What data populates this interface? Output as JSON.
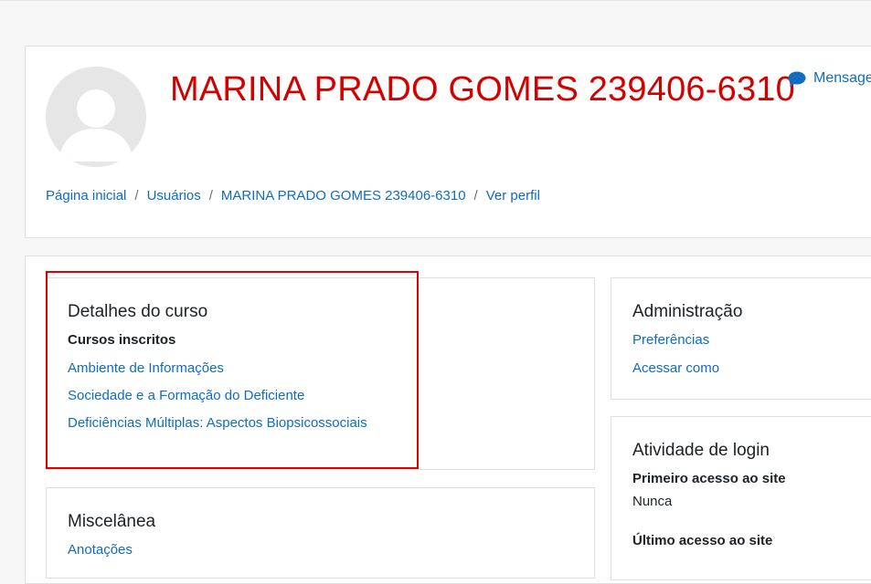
{
  "header": {
    "title": "MARINA PRADO GOMES 239406-6310",
    "message_label": "Mensage",
    "title_color": "#d40000"
  },
  "breadcrumb": [
    "Página inicial",
    "Usuários",
    "MARINA PRADO GOMES 239406-6310",
    "Ver perfil"
  ],
  "course_details": {
    "heading": "Detalhes do curso",
    "subheading": "Cursos inscritos",
    "courses": [
      "Ambiente de Informações",
      "Sociedade e a Formação do Deficiente",
      "Deficiências Múltiplas: Aspectos Biopsicossociais"
    ]
  },
  "misc": {
    "heading": "Miscelânea",
    "items": [
      "Anotações"
    ]
  },
  "admin": {
    "heading": "Administração",
    "items": [
      "Preferências",
      "Acessar como"
    ]
  },
  "login_activity": {
    "heading": "Atividade de login",
    "first_access_label": "Primeiro acesso ao site",
    "first_access_value": "Nunca",
    "last_access_label": "Último acesso ao site"
  },
  "colors": {
    "link": "#0f6cbf",
    "highlight_border": "#e00000"
  }
}
